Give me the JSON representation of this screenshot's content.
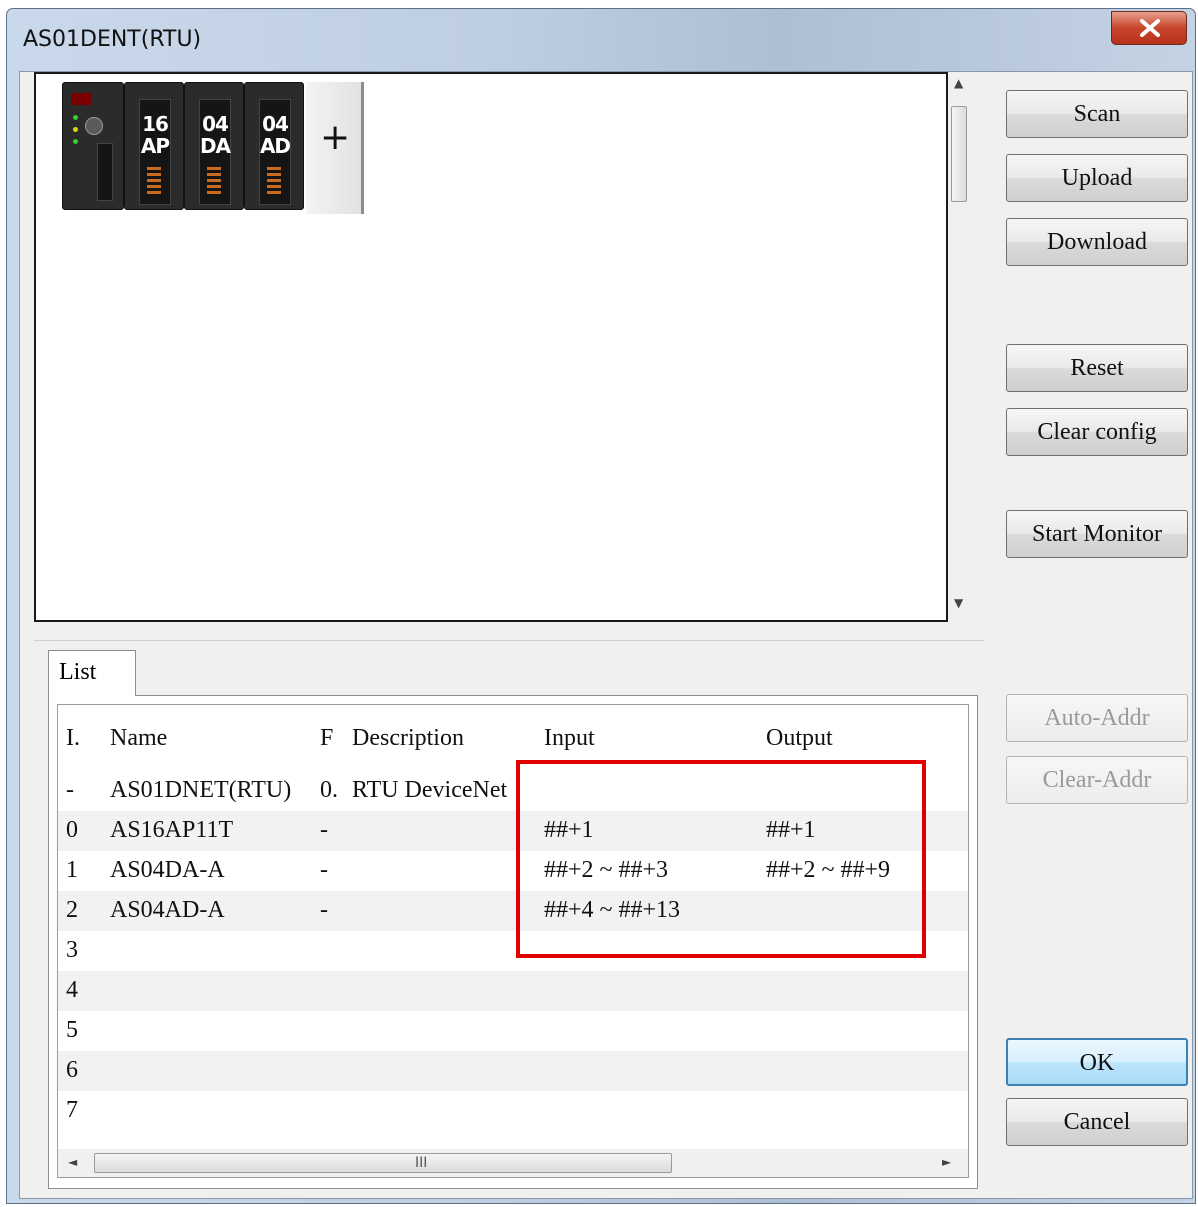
{
  "window": {
    "title": "AS01DENT(RTU)"
  },
  "modules": [
    {
      "name": "cpu-module",
      "line1": "",
      "line2": ""
    },
    {
      "name": "module-16ap",
      "line1": "16",
      "line2": "AP"
    },
    {
      "name": "module-04da",
      "line1": "04",
      "line2": "DA"
    },
    {
      "name": "module-04ad",
      "line1": "04",
      "line2": "AD"
    }
  ],
  "add_slot": "+",
  "buttons": {
    "scan": "Scan",
    "upload": "Upload",
    "download": "Download",
    "reset": "Reset",
    "clear_config": "Clear config",
    "start_monitor": "Start Monitor",
    "auto_addr": "Auto-Addr",
    "clear_addr": "Clear-Addr",
    "ok": "OK",
    "cancel": "Cancel"
  },
  "tab": {
    "label": "List"
  },
  "list": {
    "columns": [
      "I.",
      "Name",
      "F",
      "Description",
      "Input",
      "Output"
    ],
    "rows": [
      {
        "index": "-",
        "name": "AS01DNET(RTU)",
        "f": "0.",
        "description": "RTU DeviceNet",
        "input": "",
        "output": ""
      },
      {
        "index": "0",
        "name": "AS16AP11T",
        "f": "-",
        "description": "",
        "input": "##+1",
        "output": "##+1"
      },
      {
        "index": "1",
        "name": "AS04DA-A",
        "f": "-",
        "description": "",
        "input": "##+2 ~ ##+3",
        "output": "##+2 ~ ##+9"
      },
      {
        "index": "2",
        "name": "AS04AD-A",
        "f": "-",
        "description": "",
        "input": "##+4 ~ ##+13",
        "output": ""
      },
      {
        "index": "3",
        "name": "",
        "f": "",
        "description": "",
        "input": "",
        "output": ""
      },
      {
        "index": "4",
        "name": "",
        "f": "",
        "description": "",
        "input": "",
        "output": ""
      },
      {
        "index": "5",
        "name": "",
        "f": "",
        "description": "",
        "input": "",
        "output": ""
      },
      {
        "index": "6",
        "name": "",
        "f": "",
        "description": "",
        "input": "",
        "output": ""
      },
      {
        "index": "7",
        "name": "",
        "f": "",
        "description": "",
        "input": "",
        "output": ""
      }
    ]
  },
  "scrollbar": {
    "grip": "III"
  },
  "colors": {
    "highlight_box": "#e10000",
    "close_button": "#c7452d"
  }
}
